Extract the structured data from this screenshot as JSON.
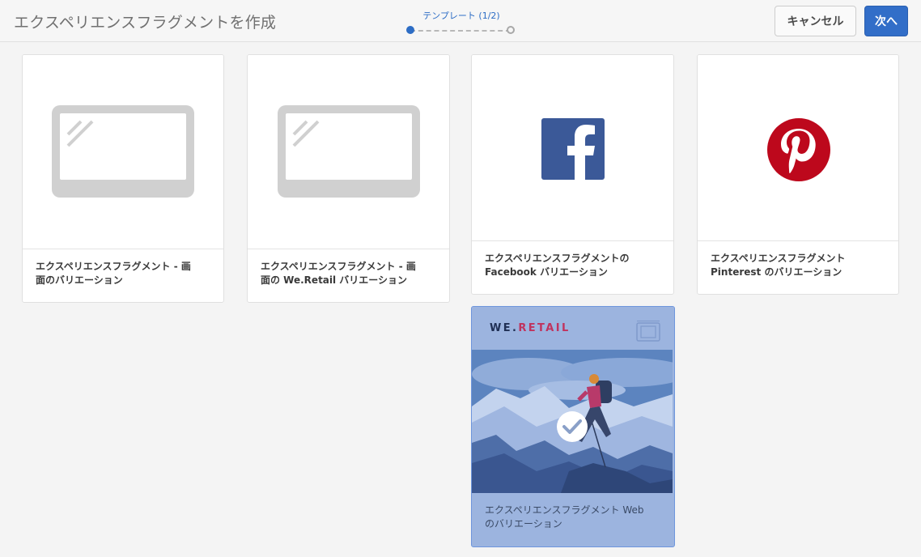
{
  "header": {
    "title": "エクスペリエンスフラグメントを作成",
    "wizard_label": "テンプレート (1/2)",
    "cancel_label": "キャンセル",
    "next_label": "次へ"
  },
  "templates": [
    {
      "icon": "screen-placeholder-icon",
      "line1": "エクスペリエンスフラグメント - 画",
      "line2": "面のバリエーション"
    },
    {
      "icon": "screen-placeholder-icon",
      "line1": "エクスペリエンスフラグメント - 画",
      "line2": "面の We.Retail バリエーション"
    },
    {
      "icon": "facebook-icon",
      "line1": "エクスペリエンスフラグメントの",
      "line2": "Facebook バリエーション"
    },
    {
      "icon": "pinterest-icon",
      "line1": "エクスペリエンスフラグメント",
      "line2": "Pinterest のバリエーション"
    },
    {
      "icon": "we-retail-hiker-image",
      "brand_main": "WE.",
      "brand_accent": "RETAIL",
      "line1": "エクスペリエンスフラグメント Web",
      "line2": "のバリエーション",
      "selected": true
    }
  ],
  "colors": {
    "accent": "#326ec8",
    "selected_overlay": "#9cb4df",
    "facebook": "#3b5998",
    "pinterest": "#bd081c",
    "placeholder": "#d0d0d0"
  }
}
